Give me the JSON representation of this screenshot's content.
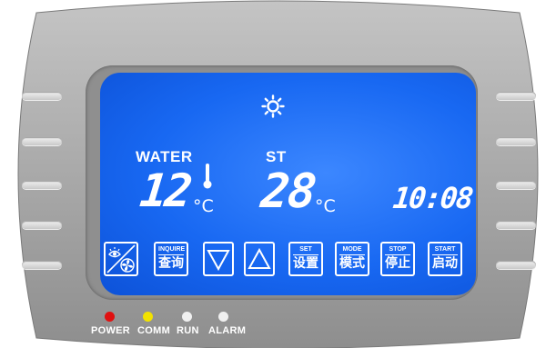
{
  "display": {
    "water_label": "WATER",
    "water_temp": "12",
    "water_unit": "°C",
    "set_label": "ST",
    "set_temp": "28",
    "set_unit": "°C",
    "clock": "10:08",
    "mode_icon": "sun-icon",
    "thermometer_icon": "thermometer-icon"
  },
  "buttons": {
    "fan": {
      "icon": "eye-fan-icon"
    },
    "inquire": {
      "en": "INQUIRE",
      "zh": "查询"
    },
    "down": {
      "icon": "triangle-down-icon"
    },
    "up": {
      "icon": "triangle-up-icon"
    },
    "set": {
      "en": "SET",
      "zh": "设置"
    },
    "mode": {
      "en": "MODE",
      "zh": "模式"
    },
    "stop": {
      "en": "STOP",
      "zh": "停止"
    },
    "start": {
      "en": "START",
      "zh": "启动"
    }
  },
  "indicators": [
    {
      "label": "POWER",
      "color": "#e01010"
    },
    {
      "label": "COMM",
      "color": "#f2e200"
    },
    {
      "label": "RUN",
      "color": "#f0f0f0"
    },
    {
      "label": "ALARM",
      "color": "#f0f0f0"
    }
  ],
  "colors": {
    "screen": "#1868f2",
    "bezel": "#9a9a9a"
  }
}
